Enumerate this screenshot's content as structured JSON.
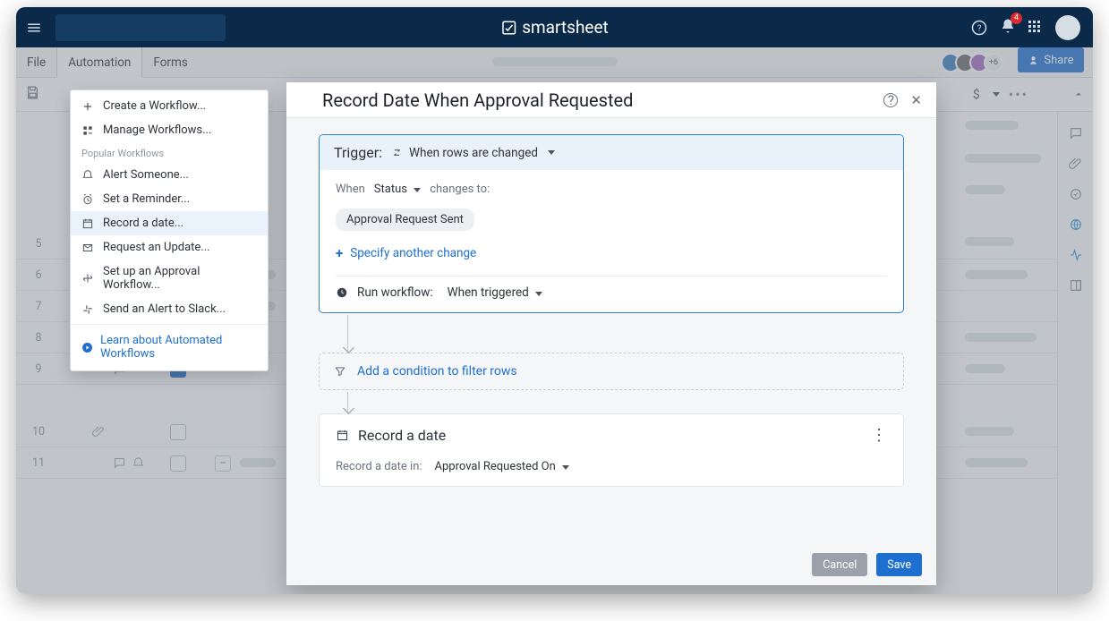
{
  "brand": "smartsheet",
  "topbar": {
    "notif_count": "4"
  },
  "menubar": {
    "file": "File",
    "automation": "Automation",
    "forms": "Forms",
    "avatars_more": "+6",
    "share": "Share"
  },
  "toolbar": {
    "currency": "$"
  },
  "dropdown": {
    "create": "Create a Workflow...",
    "manage": "Manage Workflows...",
    "popular_header": "Popular Workflows",
    "alert": "Alert Someone...",
    "reminder": "Set a Reminder...",
    "record": "Record a date...",
    "request": "Request an Update...",
    "approval": "Set up an Approval Workflow...",
    "slack": "Send an Alert to Slack...",
    "learn": "Learn about Automated Workflows"
  },
  "modal": {
    "title": "Record Date When Approval Requested",
    "trigger_label": "Trigger:",
    "trigger_type": "When rows are changed",
    "when": "When",
    "field": "Status",
    "changes_to": "changes to:",
    "chip": "Approval Request Sent",
    "specify_another": "Specify another change",
    "run_label": "Run workflow:",
    "run_value": "When triggered",
    "condition_label": "Add a condition to filter rows",
    "action_title": "Record a date",
    "action_in_label": "Record a date in:",
    "action_in_value": "Approval Requested On",
    "cancel": "Cancel",
    "save": "Save"
  },
  "rows": [
    "5",
    "6",
    "7",
    "8",
    "9",
    "10",
    "11"
  ]
}
